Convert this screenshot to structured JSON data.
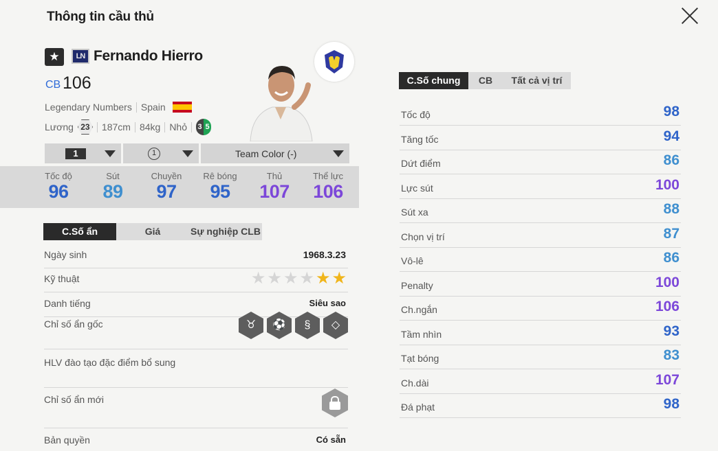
{
  "header": {
    "title": "Thông tin cầu thủ"
  },
  "player": {
    "name": "Fernando Hierro",
    "position": "CB",
    "ovr": "106",
    "season_badge": "LN",
    "season_name": "Legendary Numbers",
    "nation": "Spain",
    "salary_label": "Lương",
    "salary": "23",
    "height": "187cm",
    "weight": "84kg",
    "body": "Nhỏ",
    "foot_left": "3",
    "foot_right": "5"
  },
  "selectors": {
    "level": "1",
    "team_chem": "1",
    "team_color": "Team Color (-)"
  },
  "summary_stats": [
    {
      "label": "Tốc độ",
      "value": "96",
      "color": "#2f64c9"
    },
    {
      "label": "Sút",
      "value": "89",
      "color": "#3f8fcf"
    },
    {
      "label": "Chuyền",
      "value": "97",
      "color": "#2f64c9"
    },
    {
      "label": "Rê bóng",
      "value": "95",
      "color": "#2f64c9"
    },
    {
      "label": "Thủ",
      "value": "107",
      "color": "#7c47d9"
    },
    {
      "label": "Thể lực",
      "value": "106",
      "color": "#7c47d9"
    }
  ],
  "left_tabs": [
    "C.Số ẩn",
    "Giá",
    "Sự nghiệp CLB"
  ],
  "hidden": {
    "birthdate_label": "Ngày sinh",
    "birthdate": "1968.3.23",
    "skill_label": "Kỹ thuật",
    "skill_stars": 2,
    "skill_max": 6,
    "reputation_label": "Danh tiếng",
    "reputation": "Siêu sao",
    "traits_label": "Chỉ số ẩn gốc",
    "traits_icons": [
      "bull-icon",
      "tie-icon",
      "snake-icon",
      "diamond-icon"
    ],
    "coach_label": "HLV đào tạo đặc điểm bổ sung",
    "new_traits_label": "Chỉ số ẩn mới",
    "license_label": "Bản quyền",
    "license": "Có sẵn"
  },
  "right_tabs": [
    "C.Số chung",
    "CB",
    "Tất cả vị trí"
  ],
  "detail_stats": [
    {
      "label": "Tốc độ",
      "value": "98",
      "color": "#2f64c9"
    },
    {
      "label": "Tăng tốc",
      "value": "94",
      "color": "#2f64c9"
    },
    {
      "label": "Dứt điểm",
      "value": "86",
      "color": "#3f8fcf"
    },
    {
      "label": "Lực sút",
      "value": "100",
      "color": "#7c47d9"
    },
    {
      "label": "Sút xa",
      "value": "88",
      "color": "#3f8fcf"
    },
    {
      "label": "Chọn vị trí",
      "value": "87",
      "color": "#3f8fcf"
    },
    {
      "label": "Vô-lê",
      "value": "86",
      "color": "#3f8fcf"
    },
    {
      "label": "Penalty",
      "value": "100",
      "color": "#7c47d9"
    },
    {
      "label": "Ch.ngắn",
      "value": "106",
      "color": "#7c47d9"
    },
    {
      "label": "Tầm nhìn",
      "value": "93",
      "color": "#2f64c9"
    },
    {
      "label": "Tạt bóng",
      "value": "83",
      "color": "#3f8fcf"
    },
    {
      "label": "Ch.dài",
      "value": "107",
      "color": "#7c47d9"
    },
    {
      "label": "Đá phạt",
      "value": "98",
      "color": "#2f64c9"
    }
  ]
}
